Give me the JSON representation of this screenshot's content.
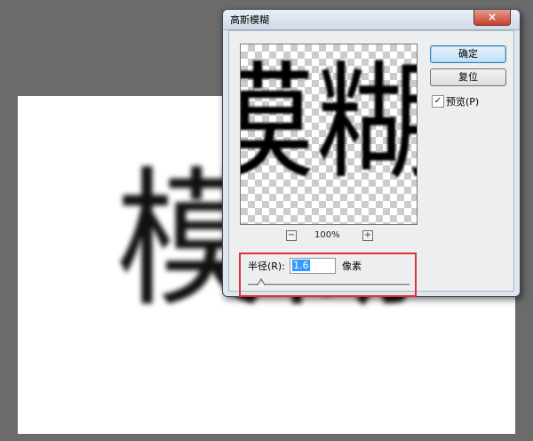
{
  "document": {
    "text": "模糊"
  },
  "dialog": {
    "title": "高斯模糊",
    "close_label": "×",
    "preview_text": "模糊",
    "zoom": {
      "out_label": "−",
      "level": "100%",
      "in_label": "+"
    },
    "buttons": {
      "ok": "确定",
      "reset": "复位"
    },
    "preview_checkbox": {
      "label": "预览(P)",
      "checked": true,
      "mark": "✓"
    },
    "radius": {
      "label": "半径(R):",
      "value": "1.6",
      "unit": "像素"
    }
  },
  "colors": {
    "highlight_box": "#e0313a",
    "selection": "#3399ff",
    "ok_button": "#bfe2f6"
  }
}
